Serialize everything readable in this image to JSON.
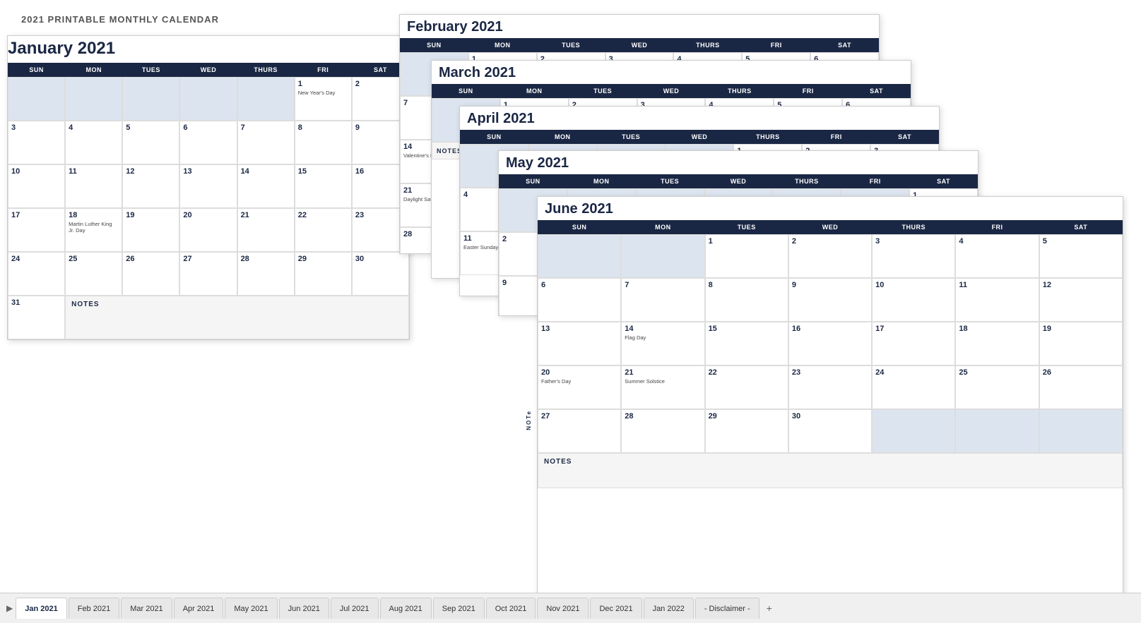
{
  "page": {
    "title": "2021 PRINTABLE MONTHLY CALENDAR"
  },
  "tabs": [
    {
      "label": "Jan 2021",
      "active": true
    },
    {
      "label": "Feb 2021",
      "active": false
    },
    {
      "label": "Mar 2021",
      "active": false
    },
    {
      "label": "Apr 2021",
      "active": false
    },
    {
      "label": "May 2021",
      "active": false
    },
    {
      "label": "Jun 2021",
      "active": false
    },
    {
      "label": "Jul 2021",
      "active": false
    },
    {
      "label": "Aug 2021",
      "active": false
    },
    {
      "label": "Sep 2021",
      "active": false
    },
    {
      "label": "Oct 2021",
      "active": false
    },
    {
      "label": "Nov 2021",
      "active": false
    },
    {
      "label": "Dec 2021",
      "active": false
    },
    {
      "label": "Jan 2022",
      "active": false
    },
    {
      "label": "- Disclaimer -",
      "active": false
    }
  ],
  "calendars": {
    "january": {
      "title": "January 2021",
      "headers": [
        "SUN",
        "MON",
        "TUES",
        "WED",
        "THURS",
        "FRI",
        "SAT"
      ]
    },
    "february": {
      "title": "February 2021",
      "headers": [
        "SUN",
        "MON",
        "TUES",
        "WED",
        "THURS",
        "FRI",
        "SAT"
      ]
    },
    "march": {
      "title": "March 2021",
      "headers": [
        "SUN",
        "MON",
        "TUES",
        "WED",
        "THURS",
        "FRI",
        "SAT"
      ]
    },
    "april": {
      "title": "April 2021",
      "headers": [
        "SUN",
        "MON",
        "TUES",
        "WED",
        "THURS",
        "FRI",
        "SAT"
      ]
    },
    "may": {
      "title": "May 2021",
      "headers": [
        "SUN",
        "MON",
        "TUES",
        "WED",
        "THURS",
        "FRI",
        "SAT"
      ]
    },
    "june": {
      "title": "June 2021",
      "headers": [
        "SUN",
        "MON",
        "TUES",
        "WED",
        "THURS",
        "FRI",
        "SAT"
      ]
    }
  },
  "notes_label": "NOTES",
  "colors": {
    "header_bg": "#1a2744",
    "empty_cell": "#dce4ef",
    "accent": "#1a2744"
  }
}
